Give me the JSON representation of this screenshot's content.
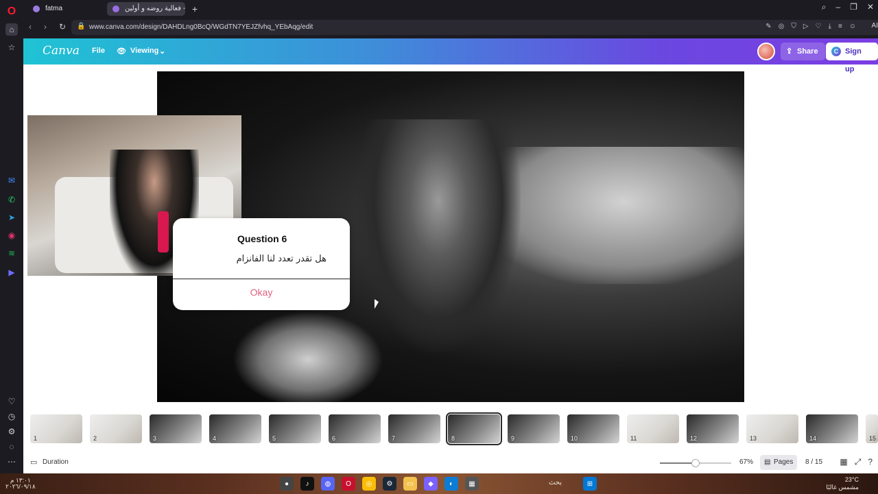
{
  "browser": {
    "tabs": [
      {
        "label": "fatma",
        "favicon_color": "#9c7be0"
      },
      {
        "label": "فعالية روضه و أولين - Presentation",
        "favicon_color": "#9a6ee6"
      }
    ],
    "url": "www.canva.com/design/DAHDLng0BcQ/WGdTN7YEJZfvhq_YEbAqg/edit",
    "ai_label": "AI"
  },
  "canva": {
    "logo": "Canva",
    "menu": {
      "file": "File",
      "viewing": "Viewing"
    },
    "share_label": "Share",
    "signup_label": "Sign up"
  },
  "modal": {
    "title": "Question 6",
    "question": "هل تقدر تعدد لنا الفانزام",
    "ok_label": "Okay"
  },
  "filmstrip": {
    "pages": [
      "1",
      "2",
      "3",
      "4",
      "5",
      "6",
      "7",
      "8",
      "9",
      "10",
      "11",
      "12",
      "13",
      "14",
      "15"
    ],
    "active_page": "8"
  },
  "footer": {
    "duration_label": "Duration",
    "zoom": "67%",
    "zoom_fraction": 0.67,
    "pages_label": "Pages",
    "page_count": "8 / 15"
  },
  "taskbar": {
    "time": "١٣:٠١ م",
    "date": "٢٠٢٦/٠٩/١٨",
    "search_label": "بحث",
    "weather_temp": "23°C",
    "weather_desc": "مشمس غالبًا"
  },
  "colors": {
    "canva_gradient_start": "#1fc3d4",
    "canva_gradient_end": "#7b3ee2",
    "ok_text": "#e0607e"
  }
}
